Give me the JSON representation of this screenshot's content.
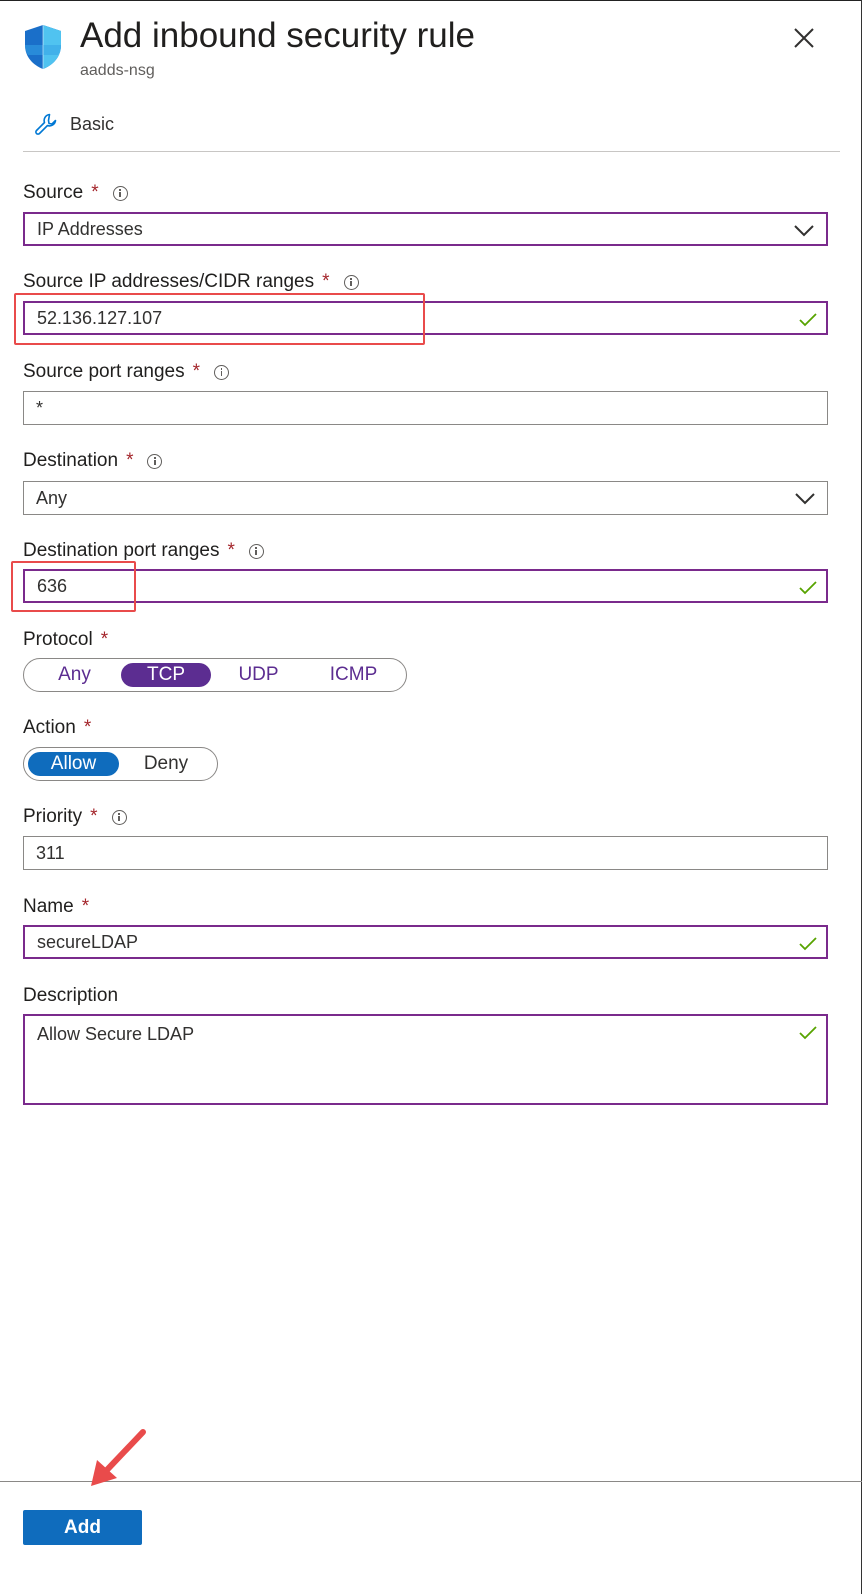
{
  "header": {
    "title": "Add inbound security rule",
    "subtitle": "aadds-nsg",
    "icon": "shield-icon",
    "close_icon": "close-icon"
  },
  "tabs": [
    {
      "label": "Basic",
      "icon": "wrench-icon"
    }
  ],
  "form": {
    "source": {
      "label": "Source",
      "required": "*",
      "value": "IP Addresses"
    },
    "source_ip": {
      "label": "Source IP addresses/CIDR ranges",
      "required": "*",
      "value": "52.136.127.107"
    },
    "source_port": {
      "label": "Source port ranges",
      "required": "*",
      "value": "*"
    },
    "destination": {
      "label": "Destination",
      "required": "*",
      "value": "Any"
    },
    "destination_port": {
      "label": "Destination port ranges",
      "required": "*",
      "value": "636"
    },
    "protocol": {
      "label": "Protocol",
      "required": "*",
      "options": [
        "Any",
        "TCP",
        "UDP",
        "ICMP"
      ],
      "selected": "TCP"
    },
    "action": {
      "label": "Action",
      "required": "*",
      "options": [
        "Allow",
        "Deny"
      ],
      "selected": "Allow"
    },
    "priority": {
      "label": "Priority",
      "required": "*",
      "value": "311"
    },
    "name": {
      "label": "Name",
      "required": "*",
      "value": "secureLDAP"
    },
    "description": {
      "label": "Description",
      "value": "Allow Secure LDAP"
    }
  },
  "footer": {
    "add_label": "Add"
  },
  "colors": {
    "accent_purple": "#5c2d91",
    "allow_blue": "#0f6cbd",
    "required_red": "#a4262c",
    "highlight_red": "#e94b4b",
    "valid_green": "#57a300"
  }
}
